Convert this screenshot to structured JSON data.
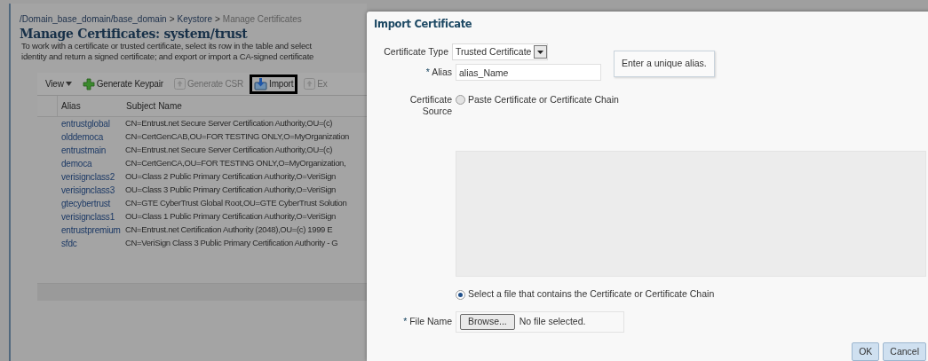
{
  "breadcrumb": {
    "links": [
      "/Domain_base_domain/base_domain",
      "Keystore"
    ],
    "separator": ">",
    "current": "Manage Certificates"
  },
  "page_title": "Manage Certificates: system/trust",
  "description": [
    "To work with a certificate or trusted certificate, select its row in the table and select",
    "identity and return a signed certificate; and export or import a CA-signed certificate"
  ],
  "toolbar": [
    {
      "label": "View",
      "kind": "menu",
      "disabled": false,
      "highlighted": false
    },
    {
      "label": "Generate Keypair",
      "kind": "add",
      "disabled": false,
      "highlighted": false
    },
    {
      "label": "Generate CSR",
      "kind": "upload",
      "disabled": true,
      "highlighted": false
    },
    {
      "label": "Import",
      "kind": "import",
      "disabled": false,
      "highlighted": true
    },
    {
      "label": "Ex",
      "kind": "upload",
      "disabled": true,
      "highlighted": false
    }
  ],
  "table": {
    "columns": [
      "Alias",
      "Subject Name"
    ],
    "rows": [
      {
        "alias": "entrustglobal",
        "subject": "CN=Entrust.net Secure Server Certification Authority,OU=(c)"
      },
      {
        "alias": "olddemoca",
        "subject": "CN=CertGenCAB,OU=FOR TESTING ONLY,O=MyOrganization"
      },
      {
        "alias": "entrustmain",
        "subject": "CN=Entrust.net Secure Server Certification Authority,OU=(c)"
      },
      {
        "alias": "democa",
        "subject": "CN=CertGenCA,OU=FOR TESTING ONLY,O=MyOrganization,"
      },
      {
        "alias": "verisignclass2",
        "subject": "OU=Class 2 Public Primary Certification Authority,O=VeriSign"
      },
      {
        "alias": "verisignclass3",
        "subject": "OU=Class 3 Public Primary Certification Authority,O=VeriSign"
      },
      {
        "alias": "gtecybertrust",
        "subject": "CN=GTE CyberTrust Global Root,OU=GTE CyberTrust Solution"
      },
      {
        "alias": "verisignclass1",
        "subject": "OU=Class 1 Public Primary Certification Authority,O=VeriSign"
      },
      {
        "alias": "entrustpremium",
        "subject": "CN=Entrust.net Certification Authority (2048),OU=(c) 1999 E"
      },
      {
        "alias": "sfdc",
        "subject": "CN=VeriSign Class 3 Public Primary Certification Authority - G"
      }
    ]
  },
  "dialog": {
    "title": "Import Certificate",
    "certificate_type": {
      "label": "Certificate Type",
      "value": "Trusted Certificate"
    },
    "alias": {
      "label": "Alias",
      "required_mark": "*",
      "value": "alias_Name",
      "tooltip": "Enter a unique alias."
    },
    "source_label": [
      "Certificate",
      "Source"
    ],
    "sources": [
      {
        "label": "Paste Certificate or Certificate Chain",
        "selected": false
      },
      {
        "label": "Select a file that contains the Certificate or Certificate Chain",
        "selected": true
      }
    ],
    "paste_area": {
      "disabled": true
    },
    "file_name": {
      "label": "File Name",
      "required_mark": "*",
      "button": "Browse...",
      "status": "No file selected."
    },
    "buttons": [
      "OK",
      "Cancel"
    ]
  }
}
